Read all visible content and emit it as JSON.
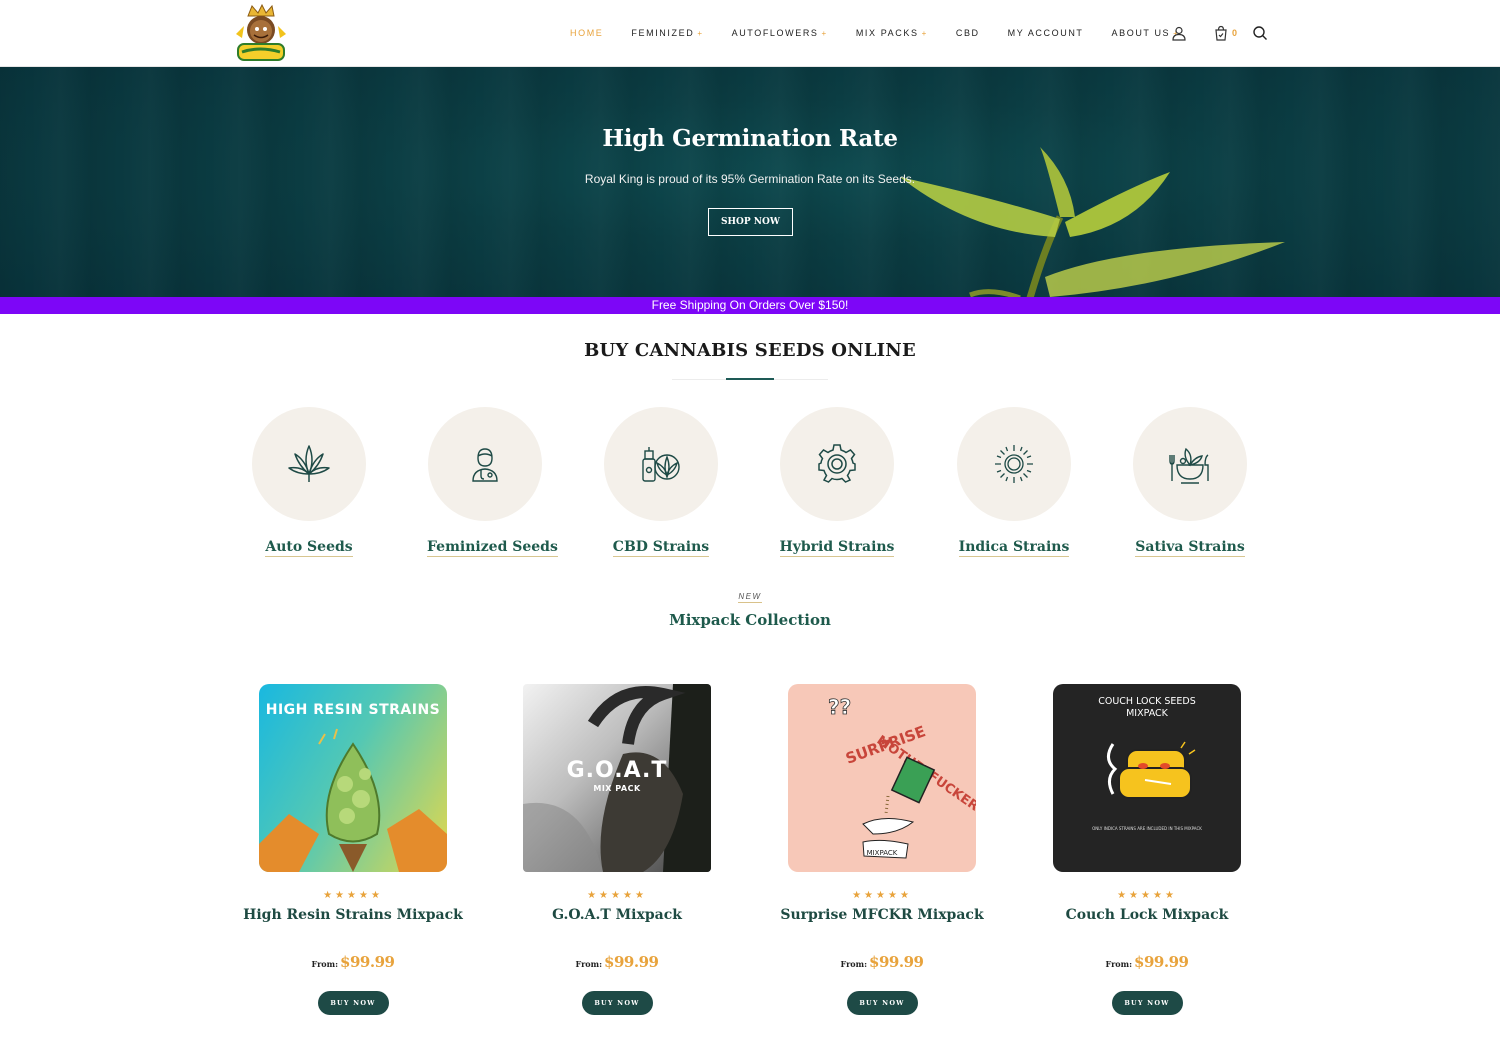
{
  "header": {
    "nav": [
      {
        "label": "HOME",
        "active": true,
        "caret": ""
      },
      {
        "label": "FEMINIZED",
        "active": false,
        "caret": "+"
      },
      {
        "label": "AUTOFLOWERS",
        "active": false,
        "caret": "+"
      },
      {
        "label": "MIX PACKS",
        "active": false,
        "caret": "+"
      },
      {
        "label": "CBD",
        "active": false,
        "caret": ""
      },
      {
        "label": "MY ACCOUNT",
        "active": false,
        "caret": ""
      },
      {
        "label": "ABOUT US",
        "active": false,
        "caret": "+"
      }
    ],
    "cart_count": "0",
    "icons": [
      "user-icon",
      "cart-icon",
      "search-icon"
    ]
  },
  "hero": {
    "title": "High Germination Rate",
    "subtitle": "Royal King is proud of its 95% Germination Rate on its Seeds.",
    "button": "SHOP NOW"
  },
  "shipping_bar": "Free Shipping On Orders Over $150!",
  "section_title": "BUY CANNABIS SEEDS ONLINE",
  "categories": [
    {
      "label": "Auto Seeds",
      "icon": "cannabis-leaf-icon"
    },
    {
      "label": "Feminized Seeds",
      "icon": "female-doctor-icon"
    },
    {
      "label": "CBD Strains",
      "icon": "cbd-oil-icon"
    },
    {
      "label": "Hybrid Strains",
      "icon": "gear-icon"
    },
    {
      "label": "Indica Strains",
      "icon": "sun-icon"
    },
    {
      "label": "Sativa Strains",
      "icon": "salad-bowl-icon"
    }
  ],
  "mixpack": {
    "tag": "NEW",
    "title": "Mixpack Collection"
  },
  "products": [
    {
      "name": "High Resin Strains Mixpack",
      "from": "From:",
      "price": "$99.99",
      "button": "BUY NOW",
      "rating": 4.5,
      "image_text": "HIGH RESIN STRAINS"
    },
    {
      "name": "G.O.A.T Mixpack",
      "from": "From:",
      "price": "$99.99",
      "button": "BUY NOW",
      "rating": 4.5,
      "image_text": "G.O.A.T",
      "image_sub": "MIX PACK"
    },
    {
      "name": "Surprise MFCKR Mixpack",
      "from": "From:",
      "price": "$99.99",
      "button": "BUY NOW",
      "rating": 4.5,
      "image_text": "SURPRISE MOTHERFUCKER",
      "image_sub": "MIXPACK"
    },
    {
      "name": "Couch Lock Mixpack",
      "from": "From:",
      "price": "$99.99",
      "button": "BUY NOW",
      "rating": 4.5,
      "image_text": "COUCH LOCK SEEDS MIXPACK",
      "image_sub": "ONLY INDICA STRAINS ARE INCLUDED IN THIS MIXPACK"
    }
  ],
  "colors": {
    "accent": "#e8a33c",
    "brand_green": "#1e4a46",
    "shipping_bar": "#7d06f7",
    "hero_bg": "#0b3d43"
  }
}
